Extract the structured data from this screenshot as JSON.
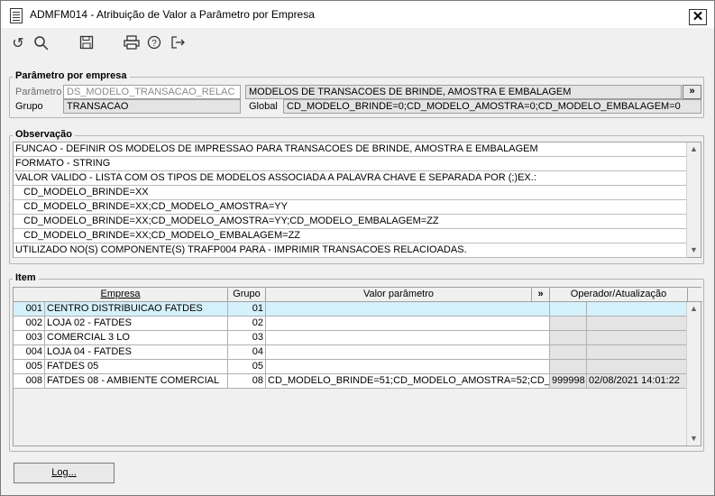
{
  "window": {
    "title": "ADMFM014 - Atribuição de Valor a Parâmetro por Empresa",
    "close_label": "✕"
  },
  "toolbar": {
    "icons": [
      "refresh-icon",
      "search-icon",
      "save-icon",
      "print-icon",
      "help-icon",
      "exit-icon"
    ]
  },
  "param": {
    "legend": "Parâmetro por empresa",
    "parametro_label": "Parâmetro",
    "parametro_value": "DS_MODELO_TRANSACAO_RELAC",
    "descricao": "MODELOS DE  TRANSACOES DE BRINDE, AMOSTRA E EMBALAGEM",
    "expand_label": "»",
    "grupo_label": "Grupo",
    "grupo_value": "TRANSACAO",
    "global_label": "Global",
    "global_value": "CD_MODELO_BRINDE=0;CD_MODELO_AMOSTRA=0;CD_MODELO_EMBALAGEM=0"
  },
  "obs": {
    "legend": "Observação",
    "lines": [
      "FUNCAO - DEFINIR OS MODELOS DE IMPRESSAO PARA TRANSACOES DE BRINDE, AMOSTRA E EMBALAGEM",
      "FORMATO - STRING",
      "VALOR VALIDO - LISTA COM OS TIPOS DE MODELOS ASSOCIADA A PALAVRA CHAVE E SEPARADA POR (;)EX.:",
      "   CD_MODELO_BRINDE=XX",
      "   CD_MODELO_BRINDE=XX;CD_MODELO_AMOSTRA=YY",
      "   CD_MODELO_BRINDE=XX;CD_MODELO_AMOSTRA=YY;CD_MODELO_EMBALAGEM=ZZ",
      "   CD_MODELO_BRINDE=XX;CD_MODELO_EMBALAGEM=ZZ",
      "UTILIZADO NO(S) COMPONENTE(S) TRAFP004 PARA  - IMPRIMIR TRANSACOES RELACIOADAS."
    ]
  },
  "item": {
    "legend": "Item",
    "headers": {
      "empresa": "Empresa",
      "grupo": "Grupo",
      "valor": "Valor parâmetro",
      "expand": "»",
      "operador": "Operador/Atualização"
    },
    "rows": [
      {
        "code": "001",
        "empresa": "CENTRO DISTRIBUICAO FATDES",
        "grupo": "01",
        "valor": "",
        "operador": "",
        "atualizacao": ""
      },
      {
        "code": "002",
        "empresa": "LOJA 02 - FATDES",
        "grupo": "02",
        "valor": "",
        "operador": "",
        "atualizacao": ""
      },
      {
        "code": "003",
        "empresa": "COMERCIAL 3 LO",
        "grupo": "03",
        "valor": "",
        "operador": "",
        "atualizacao": ""
      },
      {
        "code": "004",
        "empresa": "LOJA 04 - FATDES",
        "grupo": "04",
        "valor": "",
        "operador": "",
        "atualizacao": ""
      },
      {
        "code": "005",
        "empresa": "FATDES 05",
        "grupo": "05",
        "valor": "",
        "operador": "",
        "atualizacao": ""
      },
      {
        "code": "008",
        "empresa": "FATDES 08 - AMBIENTE COMERCIAL",
        "grupo": "08",
        "valor": "CD_MODELO_BRINDE=51;CD_MODELO_AMOSTRA=52;CD_MOD",
        "operador": "999998",
        "atualizacao": "02/08/2021 14:01:22"
      }
    ],
    "selected_index": 0
  },
  "footer": {
    "log_label": "Log..."
  },
  "colors": {
    "selected_row": "#d5f1fb",
    "readonly_field": "#e4e4e4"
  }
}
